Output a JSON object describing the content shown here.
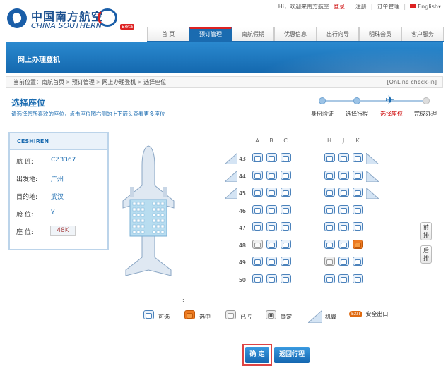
{
  "logo": {
    "cn": "中国南方航空",
    "en": "CHINA SOUTHERN",
    "beta": "Beta"
  },
  "topbar": {
    "welcome": "Hi，欢迎来南方航空",
    "login": "登录",
    "register": "注册",
    "orders": "订单管理",
    "lang": "English"
  },
  "nav": {
    "tabs": [
      {
        "label": "首 页"
      },
      {
        "label": "预订管理"
      },
      {
        "label": "南航假期"
      },
      {
        "label": "优惠信息"
      },
      {
        "label": "出行向导"
      },
      {
        "label": "明珠会员"
      },
      {
        "label": "客户服务"
      }
    ],
    "active": 1
  },
  "banner": {
    "title": "网上办理登机"
  },
  "breadcrumb": {
    "label": "当前位置：",
    "items": [
      "南航首页",
      "预订管理",
      "网上办理登机",
      "选择座位"
    ],
    "sep": ">",
    "en": "[OnLine check-in]"
  },
  "page": {
    "title": "选择座位",
    "subtitle": "请选择您所喜欢的座位，点击座位图右侧的上下箭头查看更多座位"
  },
  "steps": [
    {
      "label": "身份验证"
    },
    {
      "label": "选择行程"
    },
    {
      "label": "选择座位"
    },
    {
      "label": "完成办理"
    }
  ],
  "passenger": {
    "name": "CESHIREN",
    "rows": [
      {
        "label": "航  班:",
        "value": "CZ3367"
      },
      {
        "label": "出发地:",
        "value": "广州"
      },
      {
        "label": "目的地:",
        "value": "武汉"
      },
      {
        "label": "舱  位:",
        "value": "Y"
      },
      {
        "label": "座  位:",
        "value": "48K"
      }
    ]
  },
  "seatmap": {
    "columns_left": [
      "A",
      "B",
      "C"
    ],
    "columns_right": [
      "H",
      "J",
      "K"
    ],
    "rows": [
      "43",
      "44",
      "45",
      "46",
      "47",
      "48",
      "49",
      "50"
    ],
    "occupied": [
      "48A",
      "49H"
    ],
    "selected": [
      "48K"
    ],
    "wing_rows": [
      "43",
      "44",
      "45"
    ],
    "page_up": "前排",
    "page_down": "后排"
  },
  "note": ":",
  "legend": [
    {
      "label": "可选",
      "icon": "seat-available-icon"
    },
    {
      "label": "选中",
      "icon": "seat-selected-icon"
    },
    {
      "label": "已占",
      "icon": "seat-occupied-icon"
    },
    {
      "label": "锁定",
      "icon": "seat-locked-icon"
    },
    {
      "label": "机翼",
      "icon": "wing-icon"
    },
    {
      "label": "安全出口",
      "icon": "exit-icon",
      "exit": "EXIT"
    }
  ],
  "buttons": {
    "confirm": "确 定",
    "back": "返回行程"
  }
}
